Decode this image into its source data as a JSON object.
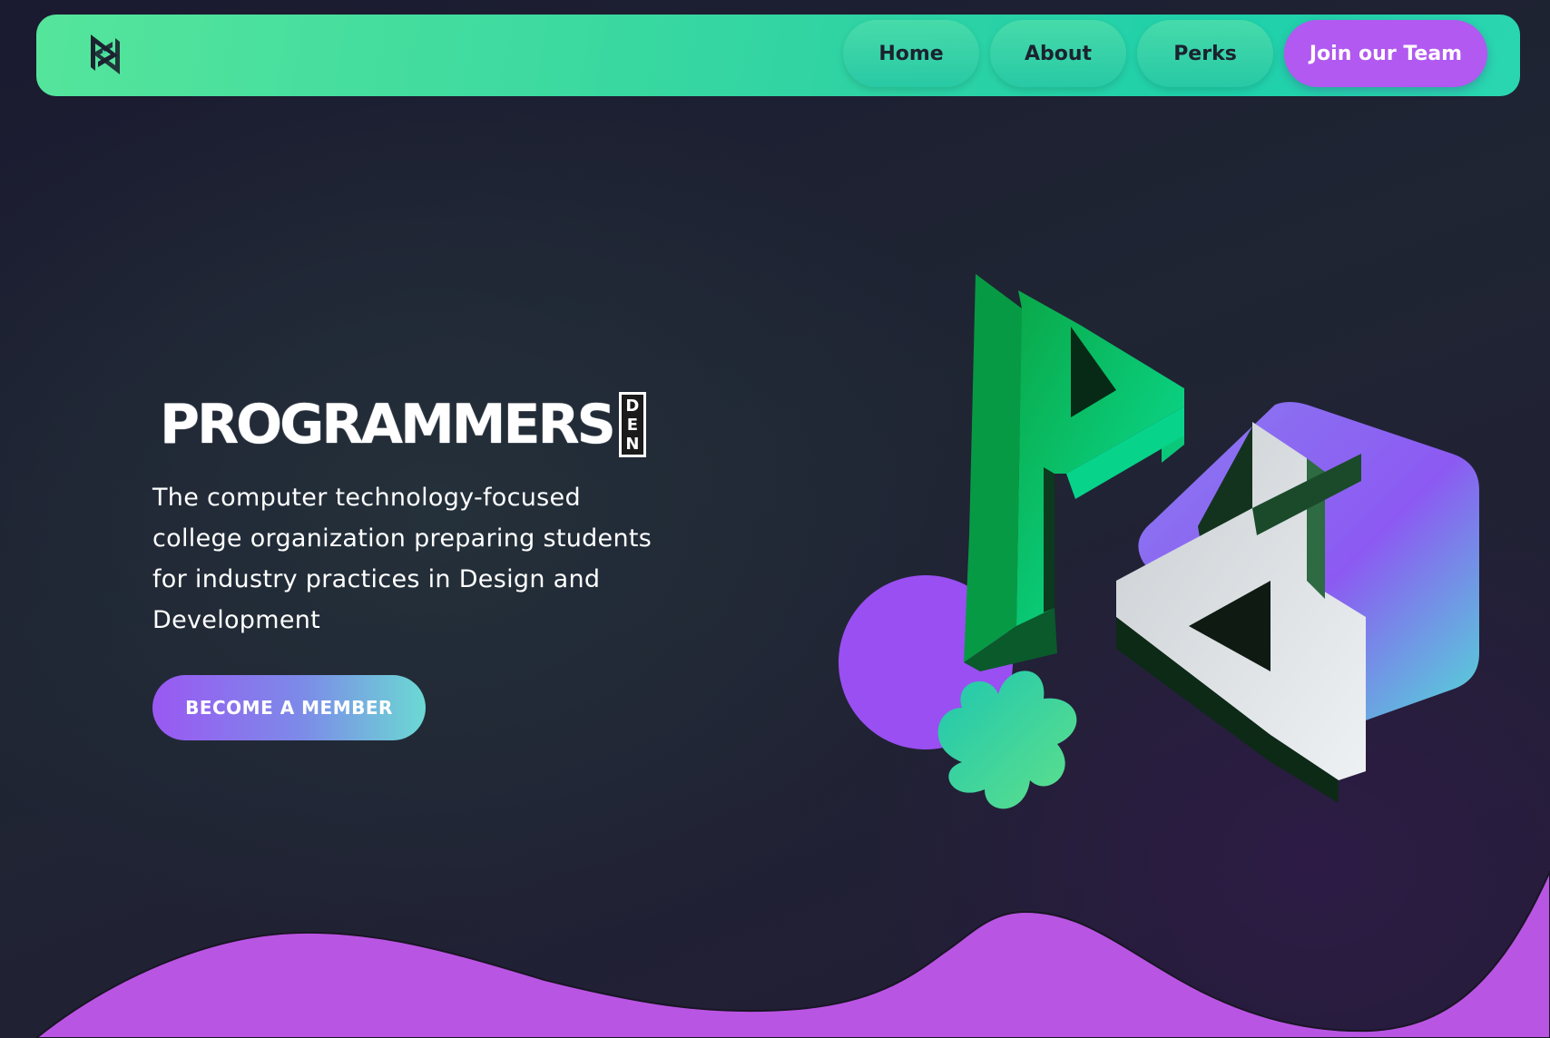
{
  "nav": {
    "links": [
      "Home",
      "About",
      "Perks"
    ],
    "cta_label": "Join our Team",
    "logo_icon": "pd-monogram-icon"
  },
  "hero": {
    "wordmark": "PROGRAMMERS",
    "den_letters": [
      "D",
      "E",
      "N"
    ],
    "tagline_lines": [
      "The computer technology-focused",
      "college organization preparing students",
      "for industry practices in Design and",
      "Development"
    ],
    "cta_label": "BECOME A MEMBER"
  },
  "colors": {
    "nav_gradient_start": "#55e59b",
    "nav_gradient_end": "#1fd0aa",
    "accent_purple": "#b159f0",
    "wave_purple": "#b955e3",
    "background": "#1f2533"
  },
  "illustration": {
    "description_icon": "3d-pd-logo-illustration"
  }
}
